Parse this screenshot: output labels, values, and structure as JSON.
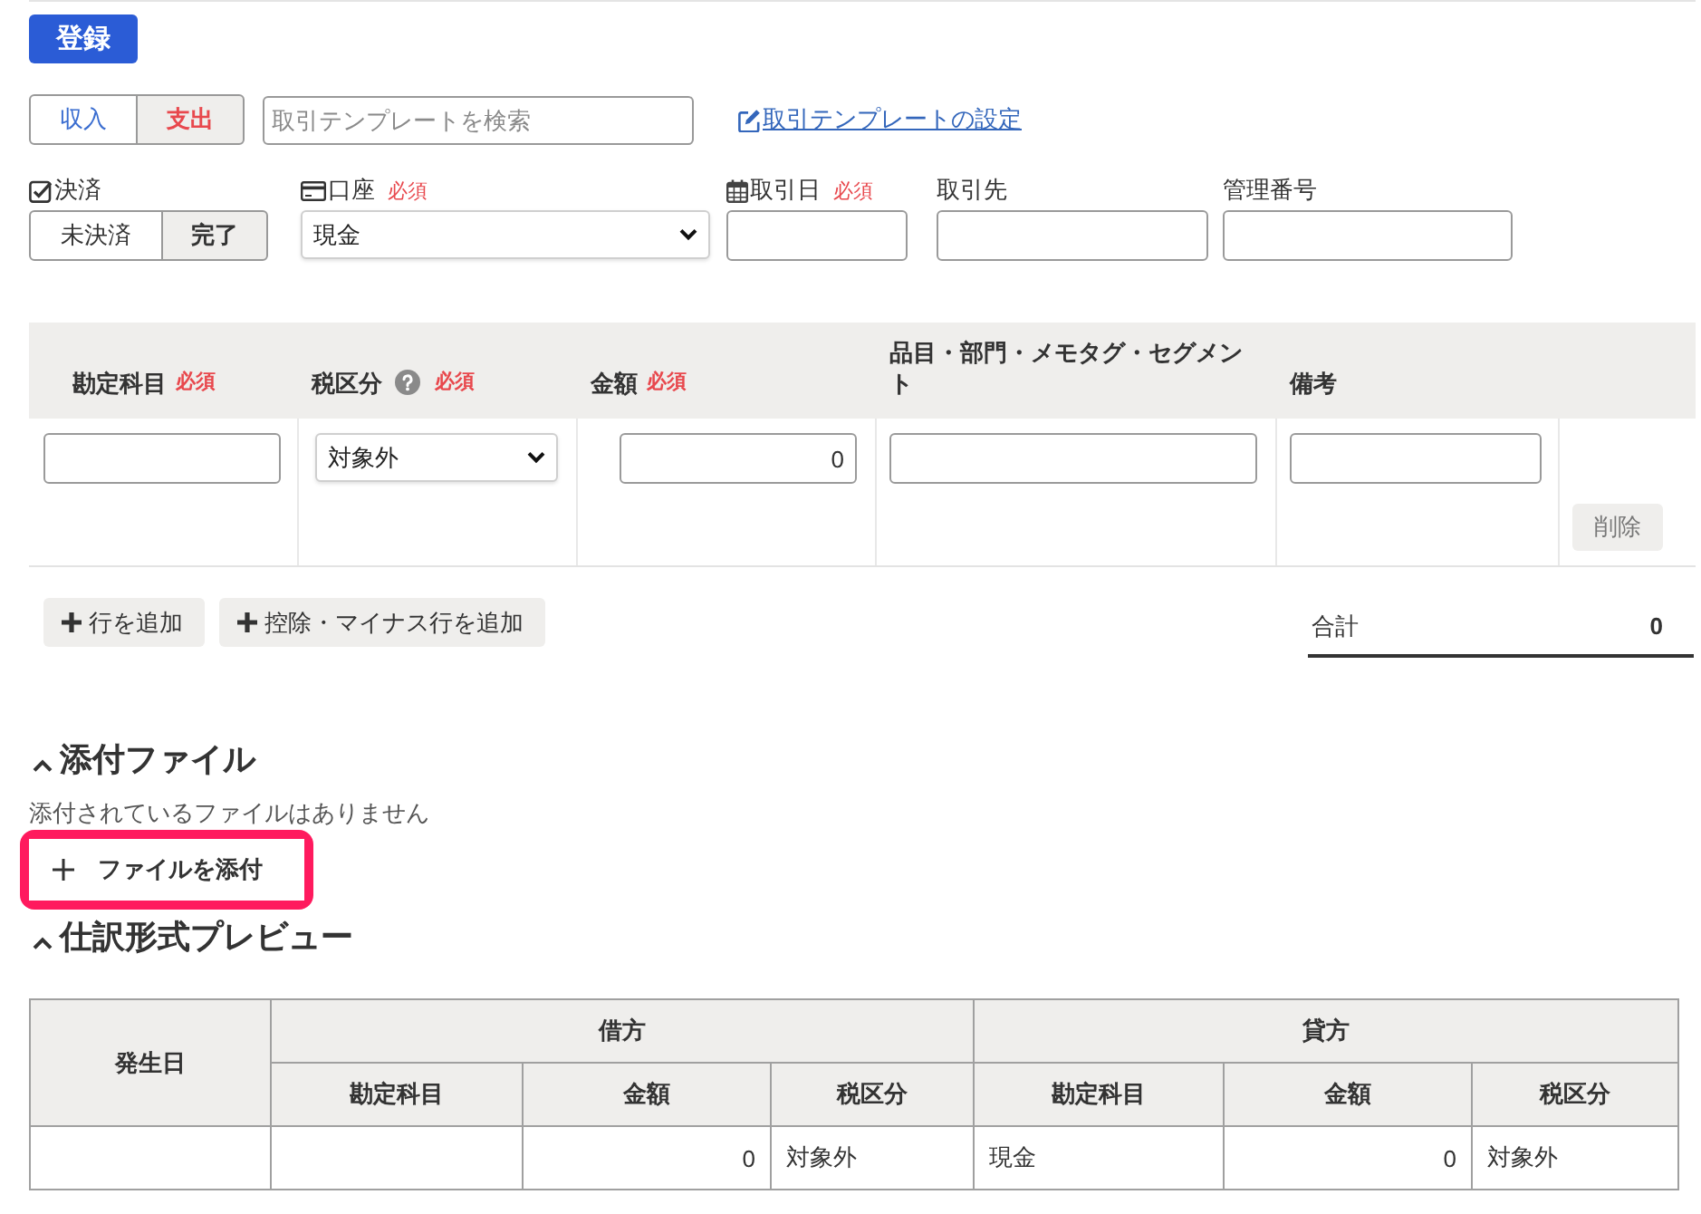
{
  "register_button": {
    "label": "登録"
  },
  "transaction_type": [
    {
      "label": "収入",
      "selected": false,
      "color": "#3a6dd0"
    },
    {
      "label": "支出",
      "selected": true,
      "color": "#e8484d"
    }
  ],
  "template_search": {
    "placeholder": "取引テンプレートを検索"
  },
  "template_settings_link": {
    "label": "取引テンプレートの設定"
  },
  "settlement": {
    "label": "決済",
    "options": [
      {
        "label": "未決済",
        "selected": false
      },
      {
        "label": "完了",
        "selected": true
      }
    ]
  },
  "fields": [
    {
      "kind": "account",
      "label": "口座",
      "required": "必須",
      "value": "現金"
    },
    {
      "kind": "date",
      "label": "取引日",
      "required": "必須"
    },
    {
      "kind": "text",
      "label": "取引先"
    },
    {
      "kind": "text",
      "label": "管理番号"
    }
  ],
  "entry_table": {
    "columns": [
      {
        "label": "勘定科目",
        "required": "必須"
      },
      {
        "label": "税区分",
        "help": true,
        "required": "必須"
      },
      {
        "label": "金額",
        "required": "必須"
      },
      {
        "label": "品目・部門・メモタグ・セグメント"
      },
      {
        "label": "備考"
      }
    ],
    "rows": [
      {
        "cells": [
          {
            "kind": "text"
          },
          {
            "kind": "select",
            "value": "対象外"
          },
          {
            "kind": "amount",
            "value": "0"
          },
          {
            "kind": "text"
          },
          {
            "kind": "text"
          },
          {
            "kind": "delete",
            "label": "削除"
          }
        ]
      }
    ]
  },
  "row_buttons": [
    {
      "label": "行を追加"
    },
    {
      "label": "控除・マイナス行を追加"
    }
  ],
  "total": {
    "label": "合計",
    "value": "0"
  },
  "attachments": {
    "title": "添付ファイル",
    "expanded": true,
    "empty_text": "添付されているファイルはありません",
    "add_button": {
      "label": "ファイルを添付",
      "highlighted": true
    }
  },
  "journal_preview": {
    "title": "仕訳形式プレビュー",
    "expanded": true,
    "table": {
      "date_header": "発生日",
      "groups": [
        {
          "label": "借方",
          "columns": [
            "勘定科目",
            "金額",
            "税区分"
          ]
        },
        {
          "label": "貸方",
          "columns": [
            "勘定科目",
            "金額",
            "税区分"
          ]
        }
      ],
      "rows": [
        {
          "sides": [
            {
              "amount": "0",
              "tax": "対象外"
            },
            {
              "account": "現金",
              "amount": "0",
              "tax": "対象外"
            }
          ]
        }
      ]
    }
  }
}
